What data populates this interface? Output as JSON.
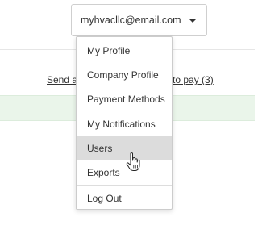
{
  "account": {
    "email": "myhvacllc@email.com"
  },
  "background": {
    "link_left": "Send a",
    "link_right": "to pay (3)"
  },
  "menu": {
    "items": [
      {
        "label": "My Profile"
      },
      {
        "label": "Company Profile"
      },
      {
        "label": "Payment Methods"
      },
      {
        "label": "My Notifications"
      },
      {
        "label": "Users",
        "state": "hovered"
      },
      {
        "label": "Exports"
      },
      {
        "label": "Log Out"
      }
    ]
  },
  "icons": {
    "account_caret": "caret-down-icon",
    "pointer": "hand-cursor-icon"
  }
}
